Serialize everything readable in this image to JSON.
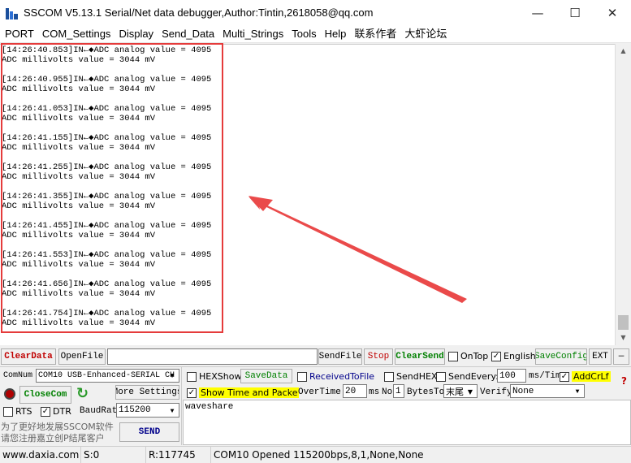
{
  "window": {
    "title": "SSCOM V5.13.1 Serial/Net data debugger,Author:Tintin,2618058@qq.com",
    "minimize": "—",
    "maximize": "☐",
    "close": "✕"
  },
  "menu": [
    "PORT",
    "COM_Settings",
    "Display",
    "Send_Data",
    "Multi_Strings",
    "Tools",
    "Help",
    "联系作者",
    "大虾论坛"
  ],
  "log": [
    {
      "time": "[14:26:40.853]IN←◆ADC analog value = 4095",
      "mv": "ADC millivolts value = 3044 mV"
    },
    {
      "time": "[14:26:40.955]IN←◆ADC analog value = 4095",
      "mv": "ADC millivolts value = 3044 mV"
    },
    {
      "time": "[14:26:41.053]IN←◆ADC analog value = 4095",
      "mv": "ADC millivolts value = 3044 mV"
    },
    {
      "time": "[14:26:41.155]IN←◆ADC analog value = 4095",
      "mv": "ADC millivolts value = 3044 mV"
    },
    {
      "time": "[14:26:41.255]IN←◆ADC analog value = 4095",
      "mv": "ADC millivolts value = 3044 mV"
    },
    {
      "time": "[14:26:41.355]IN←◆ADC analog value = 4095",
      "mv": "ADC millivolts value = 3044 mV"
    },
    {
      "time": "[14:26:41.455]IN←◆ADC analog value = 4095",
      "mv": "ADC millivolts value = 3044 mV"
    },
    {
      "time": "[14:26:41.553]IN←◆ADC analog value = 4095",
      "mv": "ADC millivolts value = 3044 mV"
    },
    {
      "time": "[14:26:41.656]IN←◆ADC analog value = 4095",
      "mv": "ADC millivolts value = 3044 mV"
    },
    {
      "time": "[14:26:41.754]IN←◆ADC analog value = 4095",
      "mv": "ADC millivolts value = 3044 mV"
    }
  ],
  "toolbar": {
    "clear_data": "ClearData",
    "open_file": "OpenFile",
    "file_path": "",
    "send_file": "SendFile",
    "stop": "Stop",
    "clear_send": "ClearSend",
    "on_top": "OnTop",
    "english": "English",
    "save_config": "SaveConfig",
    "ext": "EXT",
    "collapse": "—"
  },
  "controls": {
    "comnum_label": "ComNum",
    "com_port": "COM10 USB-Enhanced-SERIAL CH",
    "hex_show": "HEXShow",
    "save_data": "SaveData",
    "received_to_file": "ReceivedToFile",
    "send_hex": "SendHEX",
    "send_every": "SendEvery:",
    "send_every_value": "100",
    "ms_tim": "ms/Tim",
    "add_crlf": "AddCrLf",
    "close_com": "CloseCom",
    "more_settings": "More Settings",
    "show_time": "Show Time and Packe",
    "overtime_label": "OverTime:",
    "overtime_value": "20",
    "ms": "ms",
    "no_label": "No",
    "no_value": "1",
    "bytes_to": "BytesTo",
    "end_select": "末尾",
    "verify_label": "Verify",
    "verify_value": "None",
    "rts": "RTS",
    "dtr": "DTR",
    "baudrate_label": "BaudRate",
    "baudrate_value": "115200",
    "send_text": "waveshare",
    "send_button": "SEND",
    "promo_line1": "为了更好地发展SSCOM软件",
    "promo_line2": "请您注册嘉立创P结尾客户"
  },
  "status": {
    "website": "www.daxia.com",
    "sent": "S:0",
    "received": "R:117745",
    "port_info": "COM10 Opened  115200bps,8,1,None,None"
  },
  "colors": {
    "annotation": "#e53b3b",
    "red_text": "#c00000",
    "green_text": "#008000",
    "highlight": "#ffff00"
  }
}
